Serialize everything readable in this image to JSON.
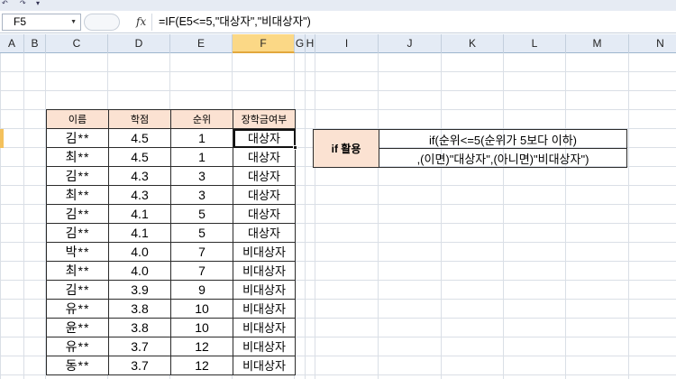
{
  "quick_access": {
    "undo_glyph": "↶",
    "redo_glyph": "↷",
    "customize_glyph": "▾"
  },
  "formula_bar": {
    "name_box": "F5",
    "fx_label": "fx",
    "formula": "=IF(E5<=5,\"대상자\",\"비대상자\")"
  },
  "columns": [
    "A",
    "B",
    "C",
    "D",
    "E",
    "F",
    "G",
    "H",
    "I",
    "J",
    "K",
    "L",
    "M",
    "N"
  ],
  "table": {
    "headers": [
      "이름",
      "학점",
      "순위",
      "장학금여부"
    ],
    "rows": [
      [
        "김**",
        "4.5",
        "1",
        "대상자"
      ],
      [
        "최**",
        "4.5",
        "1",
        "대상자"
      ],
      [
        "김**",
        "4.3",
        "3",
        "대상자"
      ],
      [
        "최**",
        "4.3",
        "3",
        "대상자"
      ],
      [
        "김**",
        "4.1",
        "5",
        "대상자"
      ],
      [
        "김**",
        "4.1",
        "5",
        "대상자"
      ],
      [
        "박**",
        "4.0",
        "7",
        "비대상자"
      ],
      [
        "최**",
        "4.0",
        "7",
        "비대상자"
      ],
      [
        "김**",
        "3.9",
        "9",
        "비대상자"
      ],
      [
        "유**",
        "3.8",
        "10",
        "비대상자"
      ],
      [
        "윤**",
        "3.8",
        "10",
        "비대상자"
      ],
      [
        "유**",
        "3.7",
        "12",
        "비대상자"
      ],
      [
        "동**",
        "3.7",
        "12",
        "비대상자"
      ]
    ],
    "active_row": 0
  },
  "info_box": {
    "label": "if 활용",
    "line1": "if(순위<=5(순위가 5보다 이하)",
    "line2": ",(이면)\"대상자\",(아니면)\"비대상자\")"
  },
  "colors": {
    "header_fill": "#fbe2d2",
    "selected_column": "#fbd886",
    "grid_line": "#dadfe6"
  }
}
